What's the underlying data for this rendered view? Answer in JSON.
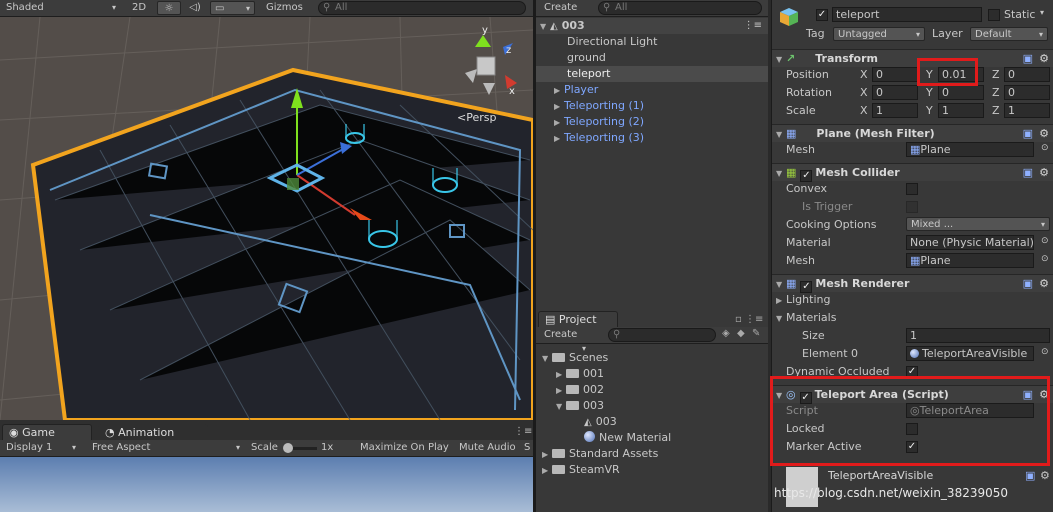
{
  "scene": {
    "shading": "Shaded",
    "mode_2d": "2D",
    "gizmos": "Gizmos",
    "search_placeholder": "All",
    "persp": "<Persp",
    "axis_y": "y",
    "axis_z": "z",
    "axis_x": "x"
  },
  "game": {
    "tab_game": "Game",
    "tab_animation": "Animation",
    "display": "Display 1",
    "aspect": "Free Aspect",
    "scale_label": "Scale",
    "scale_value": "1x",
    "maximize": "Maximize On Play",
    "mute": "Mute Audio",
    "stats": "S"
  },
  "hierarchy": {
    "create": "Create",
    "search_placeholder": "All",
    "scene_name": "003",
    "items": [
      {
        "label": "Directional Light"
      },
      {
        "label": "ground"
      },
      {
        "label": "teleport"
      },
      {
        "label": "Player"
      },
      {
        "label": "Teleporting (1)"
      },
      {
        "label": "Teleporting (2)"
      },
      {
        "label": "Teleporting (3)"
      }
    ]
  },
  "project": {
    "tab": "Project",
    "create": "Create",
    "items": [
      {
        "label": "Scenes"
      },
      {
        "label": "001"
      },
      {
        "label": "002"
      },
      {
        "label": "003"
      },
      {
        "label": "003"
      },
      {
        "label": "New Material"
      },
      {
        "label": "Standard Assets"
      },
      {
        "label": "SteamVR"
      }
    ]
  },
  "inspector": {
    "name": "teleport",
    "static": "Static",
    "tag_label": "Tag",
    "tag_value": "Untagged",
    "layer_label": "Layer",
    "layer_value": "Default",
    "transform": {
      "title": "Transform",
      "position_label": "Position",
      "rotation_label": "Rotation",
      "scale_label": "Scale",
      "x": "X",
      "y": "Y",
      "z": "Z",
      "position": [
        "0",
        "0.01",
        "0"
      ],
      "rotation": [
        "0",
        "0",
        "0"
      ],
      "scale": [
        "1",
        "1",
        "1"
      ]
    },
    "mesh_filter": {
      "title": "Plane (Mesh Filter)",
      "mesh_label": "Mesh",
      "mesh_value": "Plane"
    },
    "mesh_collider": {
      "title": "Mesh Collider",
      "convex": "Convex",
      "is_trigger": "Is Trigger",
      "cooking": "Cooking Options",
      "cooking_value": "Mixed ...",
      "material_label": "Material",
      "material_value": "None (Physic Material)",
      "mesh_label": "Mesh",
      "mesh_value": "Plane"
    },
    "mesh_renderer": {
      "title": "Mesh Renderer",
      "lighting": "Lighting",
      "materials": "Materials",
      "size_label": "Size",
      "size_value": "1",
      "element_label": "Element 0",
      "element_value": "TeleportAreaVisible",
      "dynamic": "Dynamic Occluded"
    },
    "teleport_area": {
      "title": "Teleport Area (Script)",
      "script_label": "Script",
      "script_value": "TeleportArea",
      "locked": "Locked",
      "marker": "Marker Active"
    },
    "material_name": "TeleportAreaVisible",
    "watermark": "https://blog.csdn.net/weixin_38239050"
  }
}
